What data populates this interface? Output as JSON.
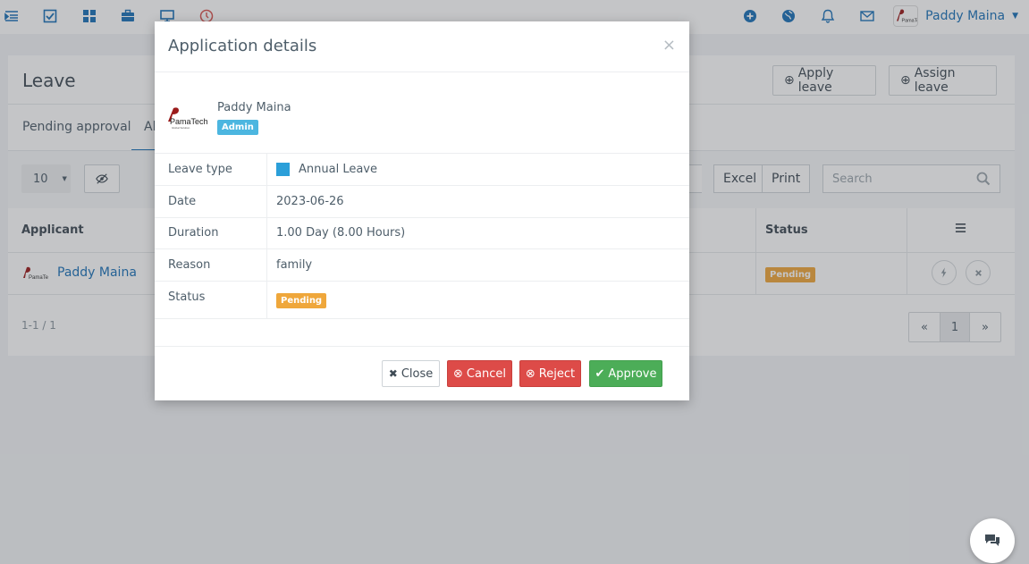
{
  "topbar": {
    "user_name": "Paddy Maina",
    "icons": [
      "menu-icon",
      "checklist-icon",
      "dashboard-icon",
      "briefcase-icon",
      "monitor-icon",
      "clock-icon",
      "plus-icon",
      "globe-icon",
      "bell-icon",
      "mail-icon"
    ]
  },
  "page": {
    "title": "Leave",
    "apply_leave": "Apply leave",
    "assign_leave": "Assign leave",
    "tabs": [
      "Pending approval",
      "Al"
    ],
    "page_size": "10",
    "excel": "Excel",
    "print": "Print",
    "search_placeholder": "Search",
    "columns": {
      "applicant": "Applicant",
      "status": "Status"
    },
    "rows": [
      {
        "applicant": "Paddy Maina",
        "status": "Pending"
      }
    ],
    "count": "1-1 / 1",
    "pager": {
      "prev": "«",
      "current": "1",
      "next": "»"
    }
  },
  "modal": {
    "title": "Application details",
    "close_x": "×",
    "user_name": "Paddy Maina",
    "role_badge": "Admin",
    "details": [
      {
        "label": "Leave type",
        "value": "Annual Leave"
      },
      {
        "label": "Date",
        "value": "2023-06-26"
      },
      {
        "label": "Duration",
        "value": "1.00 Day (8.00 Hours)"
      },
      {
        "label": "Reason",
        "value": "family"
      },
      {
        "label": "Status",
        "value": "Pending"
      }
    ],
    "buttons": {
      "close": "Close",
      "cancel": "Cancel",
      "reject": "Reject",
      "approve": "Approve"
    },
    "leave_type_color": "#2b9fd9"
  },
  "logo_text": {
    "main": "PamaTech",
    "tag": "Global Solution"
  },
  "colors": {
    "accent": "#1c72b8",
    "pending": "#efa73b",
    "admin": "#4cb6e0",
    "cancel": "#dd4b48",
    "approve": "#4cad58"
  }
}
